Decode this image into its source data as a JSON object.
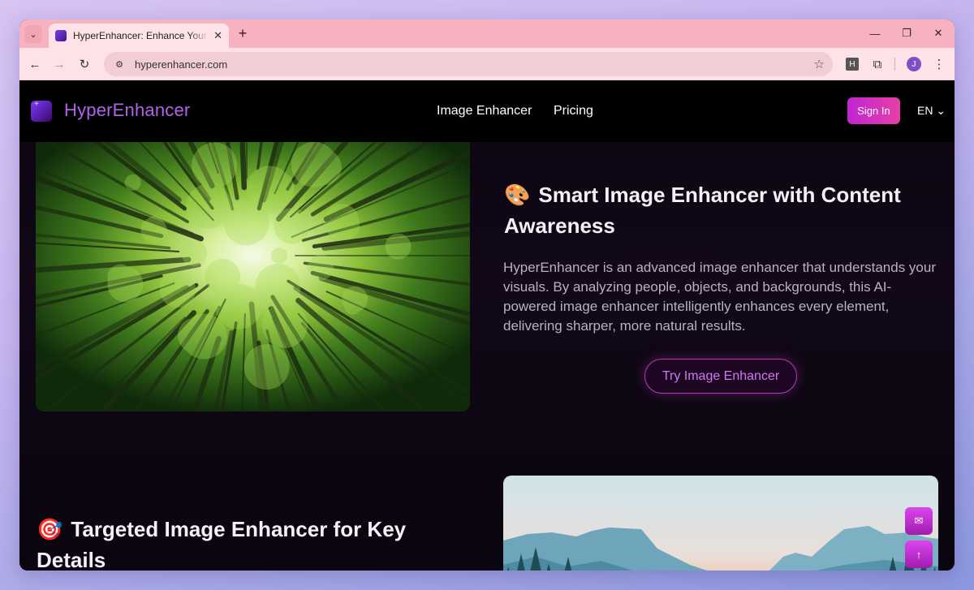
{
  "browser": {
    "tab_title": "HyperEnhancer: Enhance Your Images",
    "tab_close": "✕",
    "new_tab": "+",
    "url": "hyperenhancer.com",
    "controls": {
      "minimize": "—",
      "maximize": "❐",
      "close": "✕"
    },
    "nav": {
      "back": "←",
      "forward": "→",
      "reload": "↻"
    },
    "extension_letter": "H",
    "profile_initial": "J",
    "menu": "⋮",
    "star": "☆",
    "site_info_icon": "⚙",
    "puzzle_icon": "⧉"
  },
  "site": {
    "logo_text": "HyperEnhancer",
    "nav": [
      "Image Enhancer",
      "Pricing"
    ],
    "sign_in": "Sign In",
    "language": "EN ⌄"
  },
  "section1": {
    "emoji": "🎨",
    "title": "Smart Image Enhancer with Content Awareness",
    "description": "HyperEnhancer is an advanced image enhancer that understands your visuals. By analyzing people, objects, and backgrounds, this AI-powered image enhancer intelligently enhances every element, delivering sharper, more natural results.",
    "cta": "Try Image Enhancer"
  },
  "section2": {
    "emoji": "🎯",
    "title": "Targeted Image Enhancer for Key Details"
  },
  "floating": {
    "mail_icon": "✉",
    "top_icon": "↑"
  },
  "colors": {
    "brand": "#b062e9",
    "accent": "#d946ef"
  }
}
